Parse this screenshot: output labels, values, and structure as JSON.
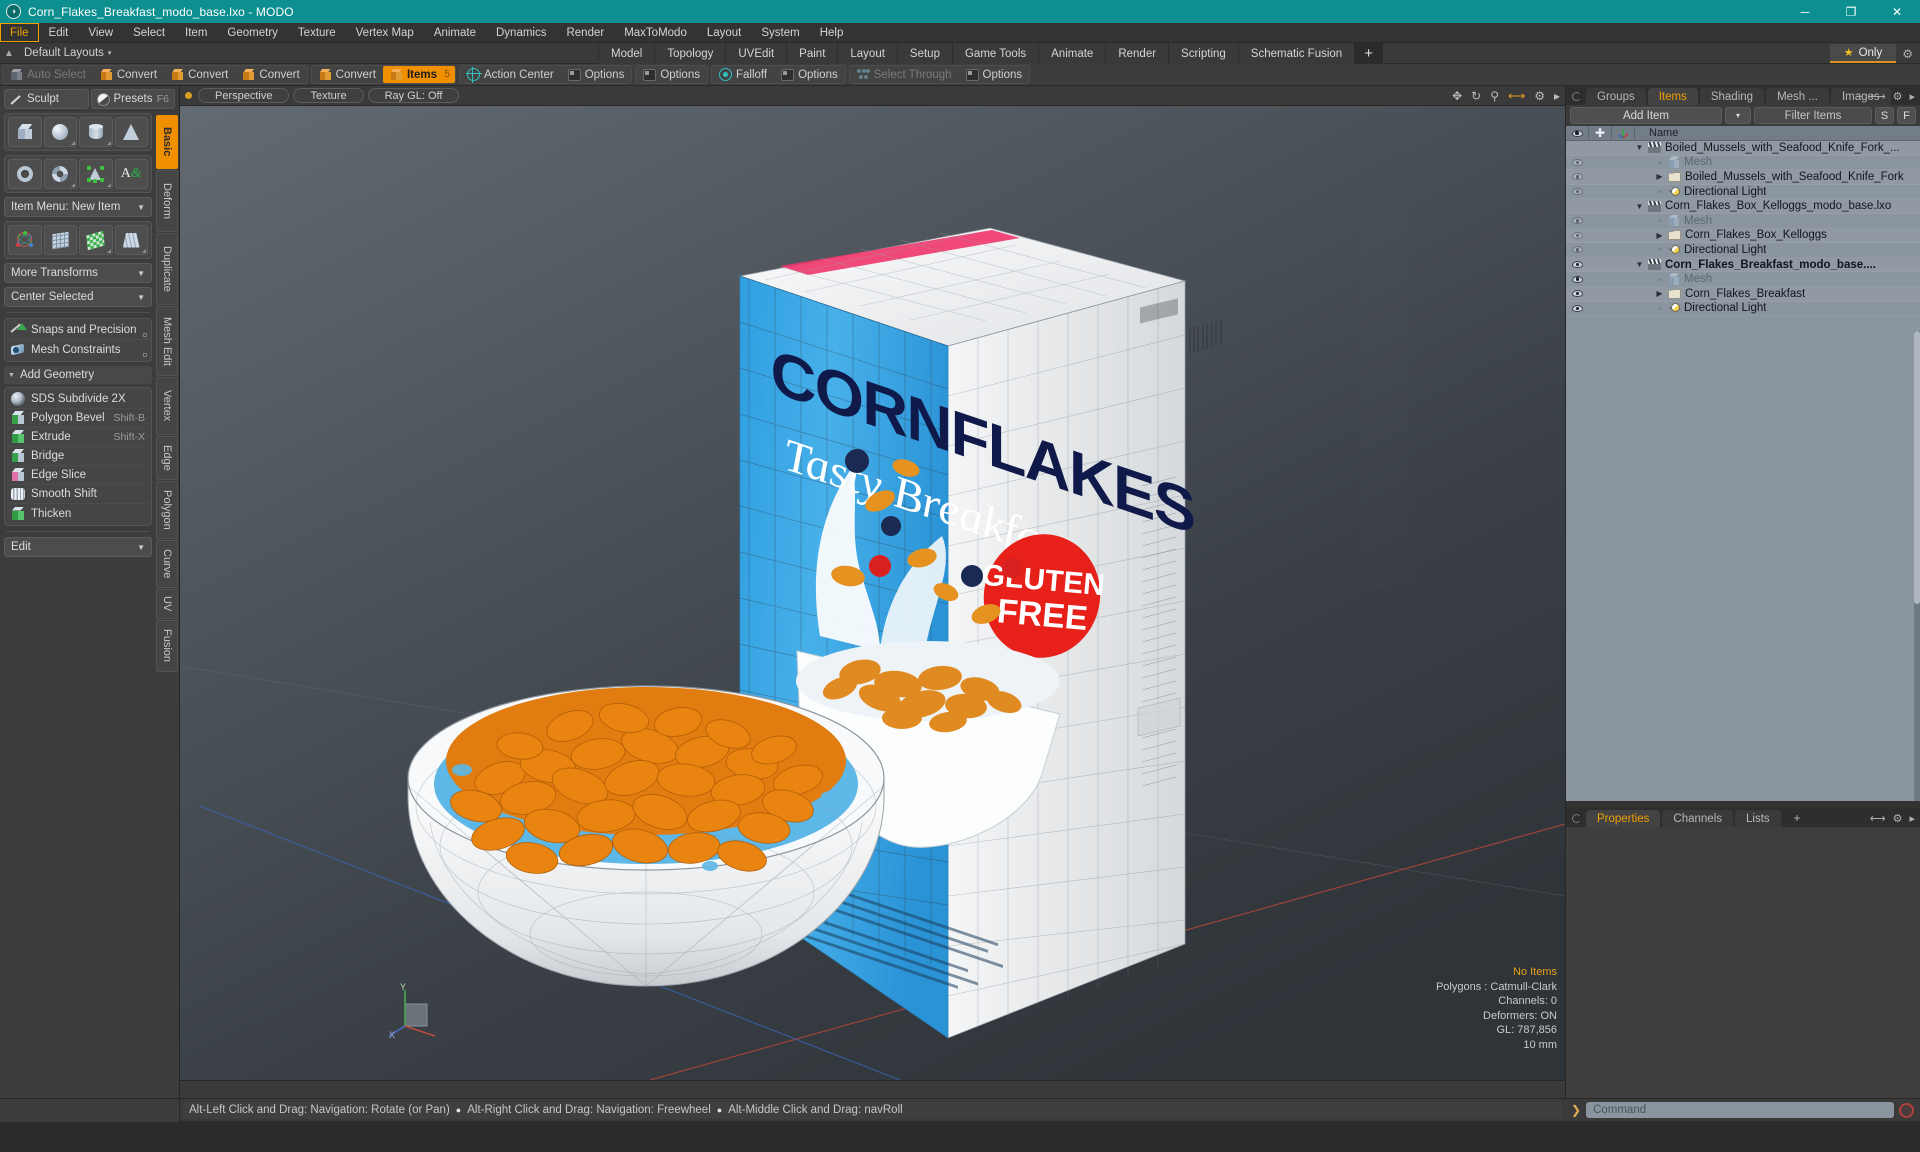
{
  "window": {
    "title": "Corn_Flakes_Breakfast_modo_base.lxo - MODO",
    "app_icon": "modo-logo-icon",
    "minimize": "─",
    "maximize": "❐",
    "close": "✕",
    "titlebar_color": "#0d8f8f"
  },
  "menubar": {
    "items": [
      {
        "label": "File",
        "active": true
      },
      {
        "label": "Edit",
        "active": false
      },
      {
        "label": "View",
        "active": false
      },
      {
        "label": "Select",
        "active": false
      },
      {
        "label": "Item",
        "active": false
      },
      {
        "label": "Geometry",
        "active": false
      },
      {
        "label": "Texture",
        "active": false
      },
      {
        "label": "Vertex Map",
        "active": false
      },
      {
        "label": "Animate",
        "active": false
      },
      {
        "label": "Dynamics",
        "active": false
      },
      {
        "label": "Render",
        "active": false
      },
      {
        "label": "MaxToModo",
        "active": false
      },
      {
        "label": "Layout",
        "active": false
      },
      {
        "label": "System",
        "active": false
      },
      {
        "label": "Help",
        "active": false
      }
    ]
  },
  "layoutbar": {
    "home_icon": "home-icon",
    "default_layouts": "Default Layouts",
    "caret": "▾",
    "tabs": [
      {
        "label": "Model"
      },
      {
        "label": "Topology"
      },
      {
        "label": "UVEdit"
      },
      {
        "label": "Paint"
      },
      {
        "label": "Layout"
      },
      {
        "label": "Setup"
      },
      {
        "label": "Game Tools"
      },
      {
        "label": "Animate"
      },
      {
        "label": "Render"
      },
      {
        "label": "Scripting"
      },
      {
        "label": "Schematic Fusion"
      }
    ],
    "add_tab": "+",
    "only_label": "Only",
    "only_star": "★",
    "gear": "⚙"
  },
  "toolbar": {
    "groups": [
      {
        "buttons": [
          {
            "label": "Auto Select",
            "icon": "cube-gray-icon",
            "state": "disabled"
          },
          {
            "label": "Convert",
            "icon": "cube-orange-icon",
            "state": "normal"
          },
          {
            "label": "Convert",
            "icon": "cube-orange-icon",
            "state": "normal"
          },
          {
            "label": "Convert",
            "icon": "cube-orange-icon",
            "state": "normal"
          }
        ]
      },
      {
        "buttons": [
          {
            "label": "Convert",
            "icon": "cube-orange-icon",
            "state": "normal"
          },
          {
            "label": "Items",
            "icon": "cube-orange-icon",
            "state": "selected",
            "badge": "5"
          }
        ]
      },
      {
        "buttons": [
          {
            "label": "Action Center",
            "icon": "crosshair-icon",
            "state": "normal"
          },
          {
            "label": "Options",
            "icon": "options-square-icon",
            "state": "normal"
          }
        ]
      },
      {
        "buttons": [
          {
            "label": "Options",
            "icon": "options-square-icon",
            "state": "normal"
          }
        ]
      },
      {
        "buttons": [
          {
            "label": "Falloff",
            "icon": "falloff-icon",
            "state": "normal"
          },
          {
            "label": "Options",
            "icon": "options-square-icon",
            "state": "normal"
          }
        ]
      },
      {
        "buttons": [
          {
            "label": "Select Through",
            "icon": "select-through-icon",
            "state": "disabled"
          },
          {
            "label": "Options",
            "icon": "options-square-icon",
            "state": "normal"
          }
        ]
      }
    ]
  },
  "left_panel": {
    "header": [
      {
        "label": "Sculpt",
        "icon": "pen-icon",
        "shortcut": ""
      },
      {
        "label": "Presets",
        "icon": "sphere-icon",
        "shortcut": "F6"
      }
    ],
    "primitives_row1": [
      {
        "name": "cube-primitive",
        "icon": "box-shape"
      },
      {
        "name": "sphere-primitive",
        "icon": "sphere-shape"
      },
      {
        "name": "cylinder-primitive",
        "icon": "cylinder-shape"
      },
      {
        "name": "cone-primitive",
        "icon": "cone-shape"
      }
    ],
    "primitives_row2": [
      {
        "name": "torus-primitive",
        "icon": "torus-shape"
      },
      {
        "name": "spiral-primitive",
        "icon": "spiral-shape"
      },
      {
        "name": "polygon-primitive",
        "icon": "polygon-shape"
      },
      {
        "name": "text-primitive",
        "icon": "text-shape"
      }
    ],
    "item_menu": "Item Menu: New Item",
    "transforms_row": [
      {
        "name": "transform-gizmo",
        "icon": "gizmo-shape"
      },
      {
        "name": "mesh-grid-tool",
        "icon": "meshgrid-shape"
      },
      {
        "name": "checker-tool",
        "icon": "checker-shape"
      },
      {
        "name": "fan-tool",
        "icon": "fan-shape"
      }
    ],
    "more_transforms": "More Transforms",
    "center_selected": "Center Selected",
    "snaps": {
      "label": "Snaps and Precision",
      "icon": "snap-magnet-icon"
    },
    "mesh_constraints": {
      "label": "Mesh Constraints",
      "icon": "constraint-icon"
    },
    "add_geometry": {
      "label": "Add Geometry",
      "caret": "▾"
    },
    "geometry_tools": [
      {
        "label": "SDS Subdivide 2X",
        "shortcut": "",
        "icon": "sds-icon"
      },
      {
        "label": "Polygon Bevel",
        "shortcut": "Shift-B",
        "icon": "bevel-icon"
      },
      {
        "label": "Extrude",
        "shortcut": "Shift-X",
        "icon": "extrude-icon"
      },
      {
        "label": "Bridge",
        "shortcut": "",
        "icon": "bridge-icon"
      },
      {
        "label": "Edge Slice",
        "shortcut": "",
        "icon": "edge-slice-icon"
      },
      {
        "label": "Smooth Shift",
        "shortcut": "",
        "icon": "smooth-shift-icon"
      },
      {
        "label": "Thicken",
        "shortcut": "",
        "icon": "thicken-icon"
      }
    ],
    "edit_dropdown": "Edit",
    "vertical_tabs": [
      {
        "label": "Basic",
        "active": true
      },
      {
        "label": "Deform",
        "active": false
      },
      {
        "label": "Duplicate",
        "active": false
      },
      {
        "label": "Mesh Edit",
        "active": false
      },
      {
        "label": "Vertex",
        "active": false
      },
      {
        "label": "Edge",
        "active": false
      },
      {
        "label": "Polygon",
        "active": false
      },
      {
        "label": "Curve",
        "active": false
      },
      {
        "label": "UV",
        "active": false
      },
      {
        "label": "Fusion",
        "active": false
      }
    ]
  },
  "viewport": {
    "header_pills": [
      "Perspective",
      "Texture",
      "Ray GL: Off"
    ],
    "header_icons": [
      "move-icon",
      "rotate-icon",
      "zoom-icon",
      "fit-icon",
      "gear-icon",
      "arrow-right-icon"
    ],
    "stats": {
      "no_items": "No Items",
      "polygons": "Polygons : Catmull-Clark",
      "channels": "Channels: 0",
      "deformers": "Deformers: ON",
      "gl": "GL: 787,856",
      "scale": "10 mm"
    },
    "axis_labels": {
      "y": "Y",
      "x": "X"
    },
    "box_art": {
      "brand": "CORNFLAKES",
      "tagline": "Tasty Breakfast",
      "badge_line1": "GLUTEN",
      "badge_line2": "FREE",
      "brand_color": "#101a4a",
      "box_color": "#3aa7e8",
      "badge_color": "#e8201a"
    }
  },
  "right_panel": {
    "tabs": [
      {
        "label": "Groups",
        "active": false
      },
      {
        "label": "Items",
        "active": true
      },
      {
        "label": "Shading",
        "active": false
      },
      {
        "label": "Mesh ...",
        "active": false
      },
      {
        "label": "Images",
        "active": false
      }
    ],
    "tab_add": "+",
    "tab_icons": [
      "expand-icon",
      "gear-icon",
      "arrow-right-icon"
    ],
    "add_item": "Add Item",
    "add_item_caret": "▾",
    "filter_placeholder": "Filter Items",
    "btn_s": "S",
    "btn_f": "F",
    "columns": {
      "visibility": "eye-icon",
      "lock": "plus-icon",
      "transform": "axis-icon",
      "name": "Name"
    },
    "items": [
      {
        "name": "Boiled_Mussels_with_Seafood_Knife_Fork_...",
        "icon": "clapboard-icon",
        "indent": 0,
        "twisty": "down",
        "eye": "none",
        "dim": false,
        "bold": false
      },
      {
        "name": "Mesh",
        "icon": "mesh-icon",
        "indent": 1,
        "twisty": "none",
        "eye": "dim",
        "dim": true,
        "bold": false
      },
      {
        "name": "Boiled_Mussels_with_Seafood_Knife_Fork",
        "icon": "folder-icon",
        "indent": 1,
        "twisty": "right",
        "eye": "dim",
        "dim": false,
        "bold": false
      },
      {
        "name": "Directional Light",
        "icon": "light-icon",
        "indent": 1,
        "twisty": "none",
        "eye": "dim",
        "dim": false,
        "bold": false
      },
      {
        "name": "Corn_Flakes_Box_Kelloggs_modo_base.lxo",
        "icon": "clapboard-icon",
        "indent": 0,
        "twisty": "down",
        "eye": "none",
        "dim": false,
        "bold": false
      },
      {
        "name": "Mesh",
        "icon": "mesh-icon",
        "indent": 1,
        "twisty": "none",
        "eye": "dim",
        "dim": true,
        "bold": false
      },
      {
        "name": "Corn_Flakes_Box_Kelloggs",
        "icon": "folder-icon",
        "indent": 1,
        "twisty": "right",
        "eye": "dim",
        "dim": false,
        "bold": false
      },
      {
        "name": "Directional Light",
        "icon": "light-icon",
        "indent": 1,
        "twisty": "none",
        "eye": "dim",
        "dim": false,
        "bold": false
      },
      {
        "name": "Corn_Flakes_Breakfast_modo_base....",
        "icon": "clapboard-icon",
        "indent": 0,
        "twisty": "down",
        "eye": "on",
        "dim": false,
        "bold": true
      },
      {
        "name": "Mesh",
        "icon": "mesh-icon",
        "indent": 1,
        "twisty": "none",
        "eye": "on",
        "dim": true,
        "bold": false
      },
      {
        "name": "Corn_Flakes_Breakfast",
        "icon": "folder-icon",
        "indent": 1,
        "twisty": "right",
        "eye": "on",
        "dim": false,
        "bold": false
      },
      {
        "name": "Directional Light",
        "icon": "light-icon",
        "indent": 1,
        "twisty": "none",
        "eye": "on",
        "dim": false,
        "bold": false
      }
    ],
    "bottom_tabs": [
      {
        "label": "Properties",
        "active": true
      },
      {
        "label": "Channels",
        "active": false
      },
      {
        "label": "Lists",
        "active": false
      }
    ],
    "bottom_tab_add": "+"
  },
  "statusbar": {
    "hints": [
      "Alt-Left Click and Drag: Navigation: Rotate (or Pan)",
      "Alt-Right Click and Drag: Navigation: Freewheel",
      "Alt-Middle Click and Drag: navRoll"
    ],
    "bullet": "●",
    "command_prompt": "❯",
    "command_placeholder": "Command",
    "record_icon": "record-icon"
  }
}
